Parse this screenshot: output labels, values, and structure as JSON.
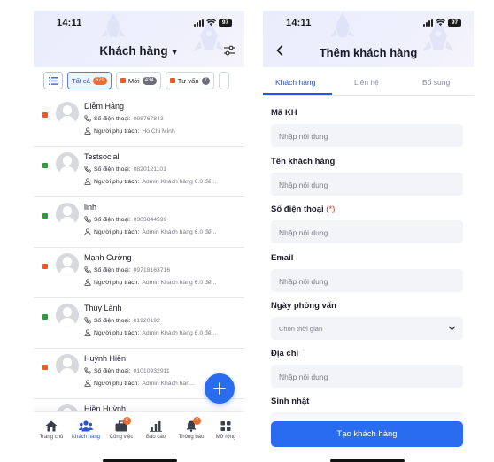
{
  "left": {
    "status_time": "14:11",
    "battery": "97",
    "title": "Khách hàng",
    "chips": [
      {
        "label": "Tất cả",
        "badge": "679",
        "active": true
      },
      {
        "label": "Mới",
        "badge": "434",
        "color": "#e85c2c"
      },
      {
        "label": "Tư vấn",
        "badge": "7",
        "color": "#e85c2c"
      }
    ],
    "phone_label": "Số điện thoại:",
    "owner_label": "Người phụ trách:",
    "customers": [
      {
        "name": "Diễm Hằng",
        "phone": "098767843",
        "owner": "Ho Chi Minh",
        "status_color": "#e85c2c"
      },
      {
        "name": "Testsocial",
        "phone": "0820121101",
        "owner": "Admin Khách hàng 6.0 đế...",
        "status_color": "#2e9a3e"
      },
      {
        "name": "linh",
        "phone": "0303844599",
        "owner": "Admin Khách hàng 6.0 đế...",
        "status_color": "#2e9a3e"
      },
      {
        "name": "Mạnh Cường",
        "phone": "09718163716",
        "owner": "Admin Khách hàng 6.0 đế...",
        "status_color": "#e85c2c"
      },
      {
        "name": "Thúy Lành",
        "phone": "01920192",
        "owner": "Admin Khách hàng 6.0 đế...",
        "status_color": "#2e9a3e"
      },
      {
        "name": "Huỳnh Hiền",
        "phone": "01010932911",
        "owner": "Admin Khách hàn...",
        "status_color": "#e85c2c"
      },
      {
        "name": "Hiền Huỳnh",
        "phone": "",
        "owner": "",
        "status_color": "#e85c2c"
      }
    ],
    "nav": [
      {
        "label": "Trang chủ",
        "icon": "home-icon"
      },
      {
        "label": "Khách hàng",
        "icon": "customers-icon",
        "active": true
      },
      {
        "label": "Công việc",
        "icon": "briefcase-icon",
        "badge": "6"
      },
      {
        "label": "Báo cáo",
        "icon": "report-icon"
      },
      {
        "label": "Thông báo",
        "icon": "bell-icon",
        "badge": "7"
      },
      {
        "label": "Mở rộng",
        "icon": "grid-icon"
      }
    ],
    "accent": "#2a6cf0"
  },
  "right": {
    "status_time": "14:11",
    "battery": "97",
    "title": "Thêm khách hàng",
    "tabs": [
      "Khách hàng",
      "Liên hệ",
      "Bổ sung"
    ],
    "fields": [
      {
        "label": "Mã KH",
        "placeholder": "Nhập nội dung"
      },
      {
        "label": "Tên khách hàng",
        "placeholder": "Nhập nội dung"
      },
      {
        "label": "Số điện thoại",
        "required": "(*)",
        "placeholder": "Nhập nội dung"
      },
      {
        "label": "Email",
        "placeholder": "Nhập nội dung"
      },
      {
        "label": "Ngày phỏng vấn",
        "placeholder": "Chọn thời gian"
      },
      {
        "label": "Địa chỉ",
        "placeholder": "Nhập nội dung"
      },
      {
        "label": "Sinh nhật",
        "placeholder": ""
      }
    ],
    "submit_label": "Tạo khách hàng"
  }
}
